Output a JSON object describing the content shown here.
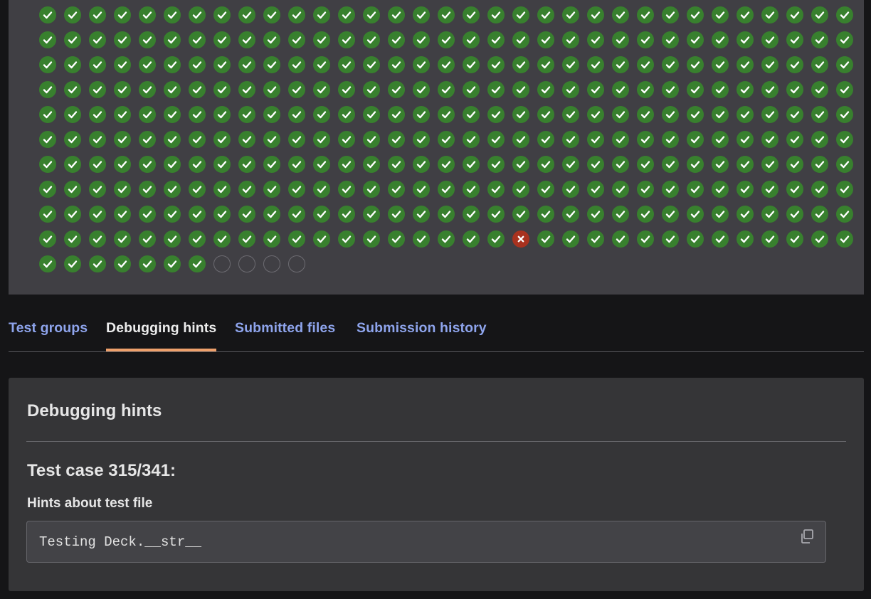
{
  "results": {
    "columns": 33,
    "rows": [
      "ppppppppppppppppppppppppppppppppp",
      "ppppppppppppppppppppppppppppppppp",
      "ppppppppppppppppppppppppppppppppp",
      "ppppppppppppppppppppppppppppppppp",
      "ppppppppppppppppppppppppppppppppp",
      "ppppppppppppppppppppppppppppppppp",
      "ppppppppppppppppppppppppppppppppp",
      "ppppppppppppppppppppppppppppppppp",
      "ppppppppppppppppppppppppppppppppp",
      "pppppppppppppppppppfppppppppppppp",
      "pppppppnnnn"
    ],
    "status_legend": {
      "p": "passed",
      "f": "failed",
      "n": "not-run"
    },
    "colors": {
      "passed": "#38802e",
      "failed": "#a8321f",
      "not-run": "#6d6c72"
    }
  },
  "tabs": [
    {
      "label": "Test groups",
      "active": false
    },
    {
      "label": "Debugging hints",
      "active": true
    },
    {
      "label": "Submitted files",
      "active": false
    },
    {
      "label": "Submission history",
      "active": false
    }
  ],
  "hints": {
    "title": "Debugging hints",
    "test_case_heading": "Test case 315/341:",
    "section_label": "Hints about test file",
    "code": "Testing Deck.__str__",
    "copy_icon": "copy-icon"
  },
  "colors": {
    "tab_link": "#8ea4ec",
    "tab_active_underline": "#eea06b"
  }
}
